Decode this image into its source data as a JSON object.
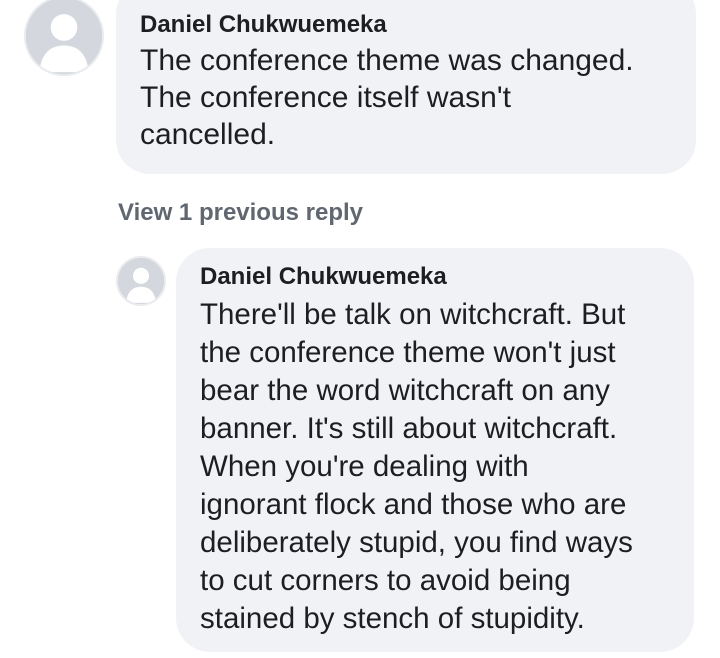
{
  "comment": {
    "author": "Daniel Chukwuemeka",
    "lines": [
      "The conference theme was changed.",
      "The conference itself wasn't",
      "cancelled."
    ],
    "avatar_icon": "default-profile-icon"
  },
  "view_replies_label": "View 1 previous reply",
  "reply": {
    "author": "Daniel Chukwuemeka",
    "lines": [
      "There'll be talk on witchcraft. But",
      "the conference theme won't just",
      "bear the word witchcraft on any",
      "banner. It's still about witchcraft.",
      "When you're dealing with",
      "ignorant flock and those who are",
      "deliberately stupid, you find ways",
      "to cut corners to avoid being",
      "stained by stench of stupidity."
    ],
    "avatar_icon": "default-profile-icon"
  },
  "colors": {
    "bubble_bg": "#f0f2f5",
    "avatar_bg": "#d4d8de",
    "avatar_silhouette": "#ffffff",
    "text": "#1c1e21",
    "secondary_text": "#606770"
  }
}
